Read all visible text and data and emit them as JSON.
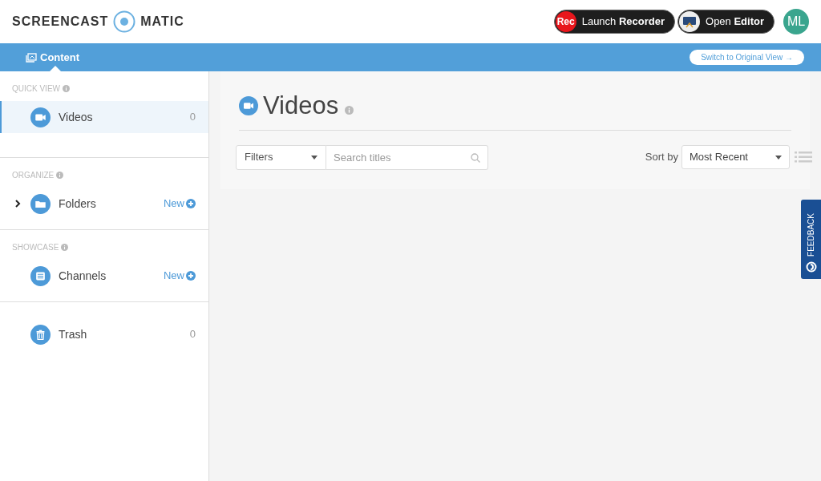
{
  "header": {
    "logo": {
      "left": "SCREENCAST",
      "right": "MATIC"
    },
    "buttons": [
      {
        "kind": "recorder",
        "badge": "Rec",
        "label": "Launch **Recorder**"
      },
      {
        "kind": "editor",
        "label": "Open **Editor**"
      }
    ],
    "avatar": "ML"
  },
  "nav": {
    "tabs": [
      {
        "label": "Content",
        "selected": true
      }
    ],
    "switch_link": "Switch to Original View →"
  },
  "sidebar": {
    "sections": [
      {
        "label": "QUICK VIEW",
        "items": [
          {
            "kind": "video",
            "label": "Videos",
            "count": "0",
            "selected": true
          }
        ]
      },
      {
        "label": "ORGANIZE",
        "items": [
          {
            "kind": "folder",
            "label": "Folders",
            "action": "New",
            "expanded": false,
            "selected": false
          }
        ]
      },
      {
        "label": "SHOWCASE",
        "items": [
          {
            "kind": "list",
            "label": "Channels",
            "action": "New",
            "selected": false
          }
        ]
      },
      {
        "items": [
          {
            "kind": "trash",
            "label": "Trash",
            "count": "0",
            "selected": false
          }
        ]
      }
    ]
  },
  "main": {
    "title": "Videos",
    "filters": "Filters",
    "search": {
      "placeholder": "Search titles"
    },
    "sort_label": "Sort by",
    "sort_value": "Most Recent"
  },
  "feedback": "FEEDBACK"
}
